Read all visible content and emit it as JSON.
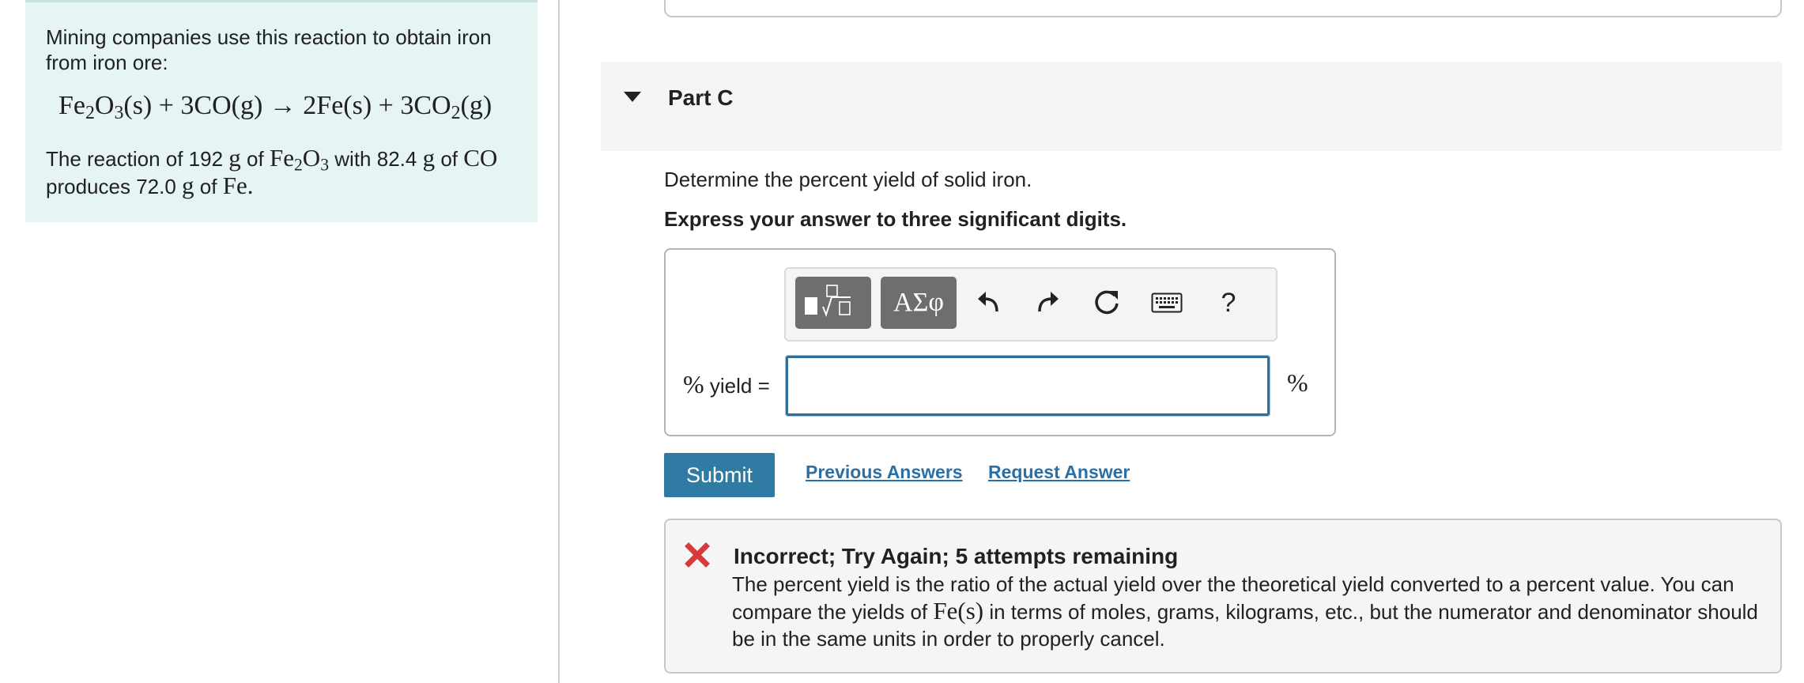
{
  "problem": {
    "intro": "Mining companies use this reaction to obtain iron from iron ore:",
    "reaction_prefix": "The reaction of",
    "mass1": "192",
    "mass2": "82.4",
    "mass3": "72.0",
    "unit_g": "g",
    "word_of": "of",
    "word_with": "with",
    "word_produces": "produces",
    "co": "CO",
    "fe": "Fe"
  },
  "part": {
    "title": "Part C",
    "question": "Determine the percent yield of solid iron.",
    "instruction": "Express your answer to three significant digits."
  },
  "toolbar": {
    "symbols_label": "ΑΣφ",
    "help_label": "?"
  },
  "answer": {
    "label": "yield =",
    "label_symbol": "%",
    "value": "",
    "unit": "%"
  },
  "actions": {
    "submit_label": "Submit",
    "previous_answers_label": "Previous Answers",
    "request_answer_label": "Request Answer"
  },
  "feedback": {
    "title": "Incorrect; Try Again; 5 attempts remaining",
    "body_1": "The percent yield is the ratio of the actual yield over the theoretical yield converted to a percent value. You can compare the yields of",
    "body_2": "in terms of moles, grams, kilograms, etc., but the numerator and denominator should be in the same units in order to properly cancel.",
    "icon": "close-icon",
    "icon_color": "#d63a3a"
  },
  "colors": {
    "panel_bg": "#e6f4f3",
    "submit_bg": "#2f7ba3",
    "link": "#2a6fa6",
    "input_border": "#2f6f99"
  }
}
